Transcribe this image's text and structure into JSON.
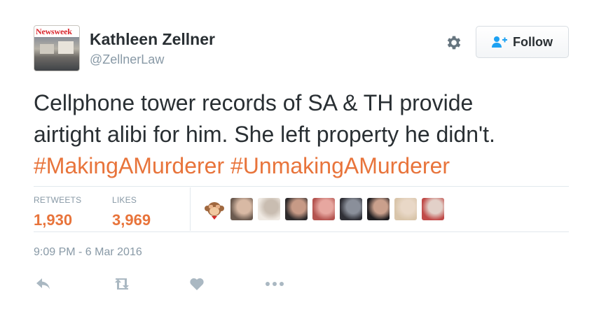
{
  "author": {
    "avatar_logo_text": "Newsweek",
    "name": "Kathleen Zellner",
    "handle": "@ZellnerLaw"
  },
  "header_actions": {
    "settings_icon": "gear-icon",
    "follow_label": "Follow",
    "follow_icon": "add-user-icon"
  },
  "tweet": {
    "line1": "Cellphone tower records of SA & TH provide",
    "line2": "airtight alibi for him. She left property he didn't.",
    "hashtags": [
      "#MakingAMurderer",
      "#UnmakingAMurderer"
    ]
  },
  "stats": {
    "retweets_label": "RETWEETS",
    "retweets_count": "1,930",
    "likes_label": "LIKES",
    "likes_count": "3,969"
  },
  "likers": [
    {
      "kind": "emoji",
      "icon": "see-no-evil-monkey-icon"
    },
    {
      "kind": "photo",
      "colors": [
        "#6b5a4f",
        "#d8b9a4"
      ]
    },
    {
      "kind": "photo",
      "colors": [
        "#efe9e2",
        "#c9bdb1"
      ]
    },
    {
      "kind": "photo",
      "colors": [
        "#2d2a2b",
        "#c79a86"
      ]
    },
    {
      "kind": "photo",
      "colors": [
        "#b45450",
        "#e7a7a0"
      ]
    },
    {
      "kind": "photo",
      "colors": [
        "#2f2f36",
        "#8a8f9a"
      ]
    },
    {
      "kind": "photo",
      "colors": [
        "#1f1d20",
        "#caa08c"
      ]
    },
    {
      "kind": "photo",
      "colors": [
        "#d9c5aa",
        "#e9d8c7"
      ]
    },
    {
      "kind": "photo",
      "colors": [
        "#c04a48",
        "#e2d0c8"
      ]
    }
  ],
  "timestamp": "9:09 PM - 6 Mar 2016",
  "actions": {
    "reply_icon": "reply-icon",
    "retweet_icon": "retweet-icon",
    "like_icon": "heart-icon",
    "more_icon": "more-icon"
  },
  "colors": {
    "accent": "#e8743b",
    "text": "#292f33",
    "muted": "#8899a6",
    "divider": "#e1e8ed",
    "icon": "#aab8c2",
    "follow_icon": "#1da1f2"
  }
}
